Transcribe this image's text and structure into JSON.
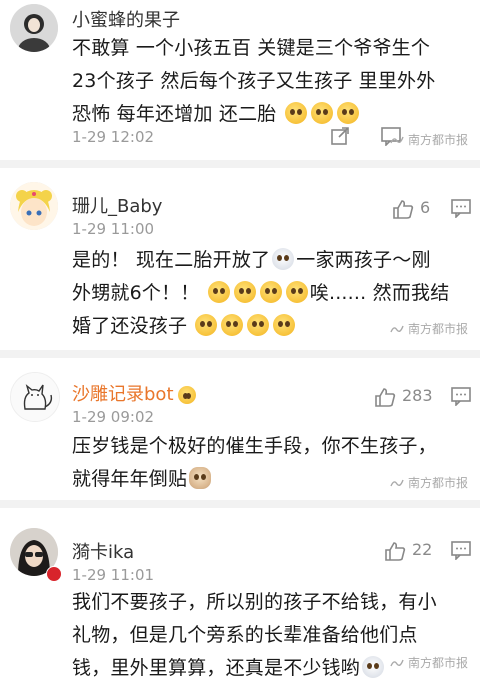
{
  "comments": [
    {
      "name": "小蜜蜂的果子",
      "time": "1-29 12:02",
      "text_lines": [
        "不敢算 一个小孩五百 关键是三个爷爷生个",
        "23个孩子 然后每个孩子又生孩子 里里外外",
        "恐怖 每年还增加 还二胎"
      ],
      "emoji": "laugh-cry-emoji ×3"
    },
    {
      "name": "珊儿_Baby",
      "time": "1-29 11:00",
      "likes": "6",
      "text_lines": [
        "是的！ 现在二胎开放了",
        "一家两孩子～刚",
        "外甥就6个！！",
        "唉...... 然而我结",
        "婚了还没孩子"
      ]
    },
    {
      "name": "沙雕记录bot",
      "time": "1-29 09:02",
      "likes": "283",
      "text_lines": [
        "压岁钱是个极好的催生手段，你不生孩子，",
        "就得年年倒贴"
      ]
    },
    {
      "name": "漪卡ika",
      "time": "1-29 11:01",
      "likes": "22",
      "text_lines": [
        "我们不要孩子，所以别的孩子不给钱，有小",
        "礼物，但是几个旁系的长辈准备给他们点",
        "钱，里外里算算，还真是不少钱哟"
      ]
    }
  ],
  "watermark": "南方都市报",
  "colors": {
    "name": "#333333",
    "name_highlight": "#e9762b",
    "time": "#9a9a9a",
    "separator": "#f2f2f2"
  }
}
